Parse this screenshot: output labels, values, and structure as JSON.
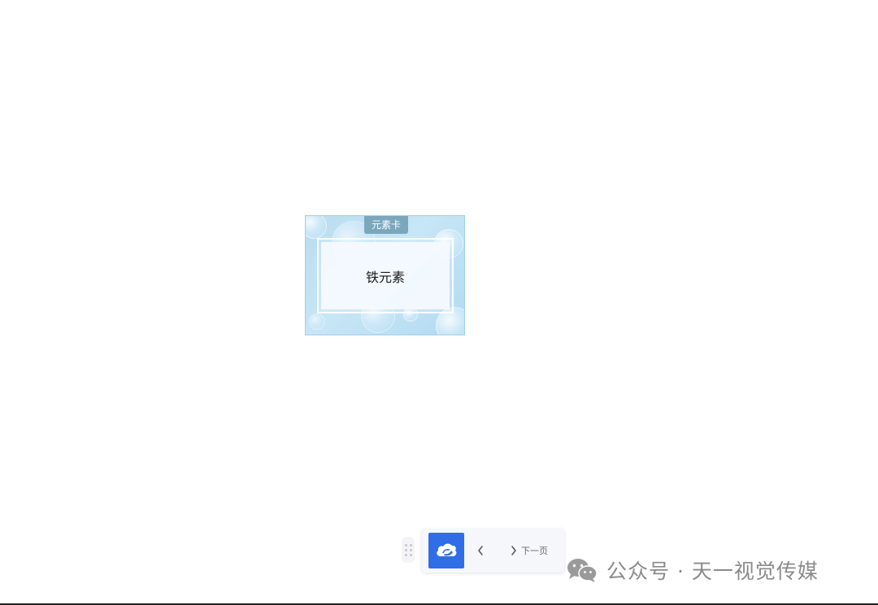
{
  "card": {
    "tag": "元素卡",
    "text": "铁元素"
  },
  "toolbar": {
    "app_icon": "cloud-app-icon",
    "prev_icon": "chevron-left-icon",
    "next_icon": "chevron-right-icon",
    "next_label": "下一页",
    "drag_icon": "drag-handle-icon",
    "accent": "#2f6ee6"
  },
  "watermark": {
    "icon": "wechat-icon",
    "text": "公众号 · 天一视觉传媒"
  }
}
